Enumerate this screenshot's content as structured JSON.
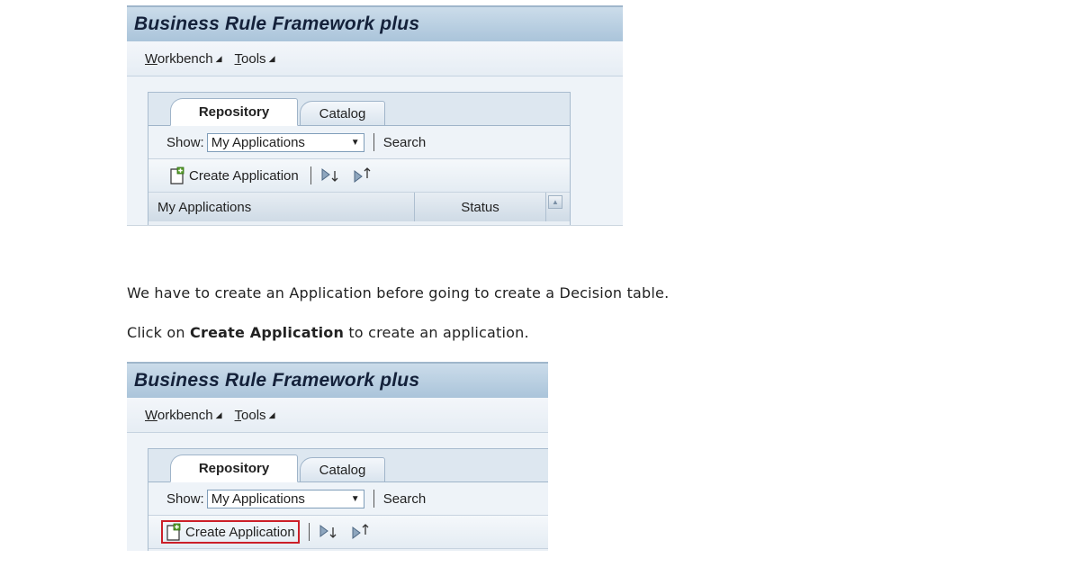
{
  "screenshot1": {
    "title": "Business Rule Framework plus",
    "menu": [
      {
        "label_ul": "W",
        "label_rest": "orkbench"
      },
      {
        "label_ul": "T",
        "label_rest": "ools"
      }
    ],
    "tabs": {
      "repository": "Repository",
      "catalog": "Catalog"
    },
    "show_label": "Show:",
    "show_value": "My Applications",
    "search_label": "Search",
    "create_label": "Create Application",
    "columns": [
      "My Applications",
      "Status"
    ]
  },
  "instructions": {
    "line1": "We have to create an Application before going to create a Decision table.",
    "line2_pre": "Click on ",
    "line2_bold": "Create Application",
    "line2_post": " to create an application."
  },
  "screenshot2": {
    "title": "Business Rule Framework plus",
    "menu": [
      {
        "label_ul": "W",
        "label_rest": "orkbench"
      },
      {
        "label_ul": "T",
        "label_rest": "ools"
      }
    ],
    "tabs": {
      "repository": "Repository",
      "catalog": "Catalog"
    },
    "show_label": "Show:",
    "show_value": "My Applications",
    "search_label": "Search",
    "create_label": "Create Application"
  },
  "icons": {
    "create": "new-document-plus-icon",
    "expand": "expand-down-icon",
    "collapse": "collapse-up-icon",
    "dropdown": "dropdown-arrow-icon",
    "scroll": "scroll-up-icon"
  },
  "colors": {
    "highlight": "#cc1f28",
    "title_bar": "#aac4da",
    "title_text": "#14213a"
  }
}
